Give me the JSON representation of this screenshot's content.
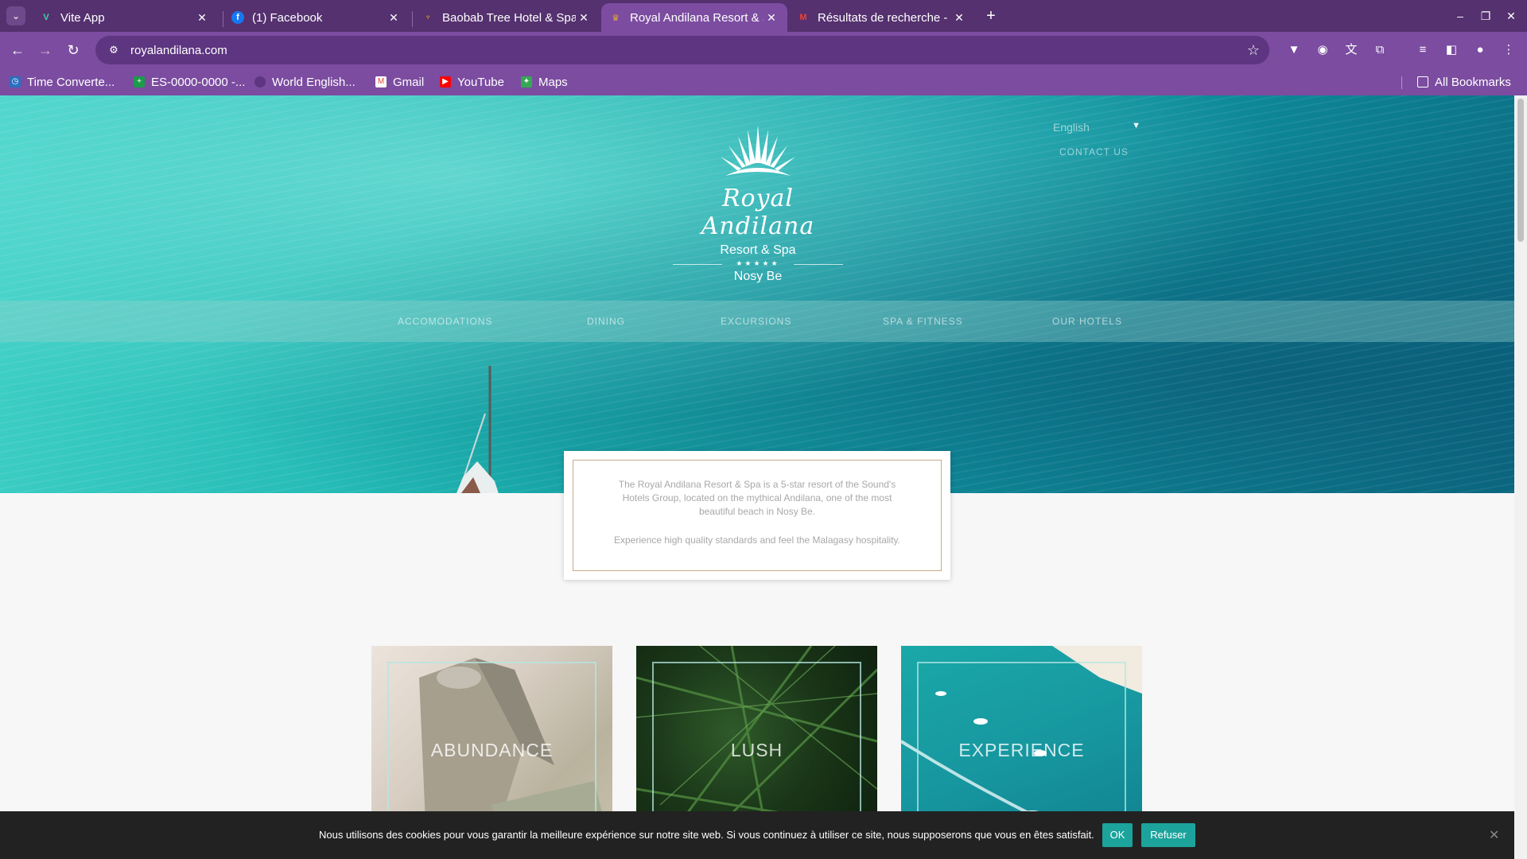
{
  "browser": {
    "tabs": [
      {
        "title": "Vite App",
        "icon": "vite-icon",
        "active": false
      },
      {
        "title": "(1) Facebook",
        "icon": "facebook-icon",
        "active": false
      },
      {
        "title": "Baobab Tree Hotel & Spa",
        "icon": "baobab-icon",
        "active": false
      },
      {
        "title": "Royal Andilana Resort & Spa",
        "icon": "royal-andilana-icon",
        "active": true
      },
      {
        "title": "Résultats de recherche - ",
        "icon": "gmail-icon",
        "active": false
      }
    ],
    "url": "royalandilana.com",
    "bookmarks": [
      {
        "label": "Time Converte...",
        "icon": "clock-icon"
      },
      {
        "label": "ES-0000-0000 -...",
        "icon": "plus-icon"
      },
      {
        "label": "World English...",
        "icon": "globe-icon"
      },
      {
        "label": "Gmail",
        "icon": "gmail-icon"
      },
      {
        "label": "YouTube",
        "icon": "youtube-icon"
      },
      {
        "label": "Maps",
        "icon": "maps-icon"
      }
    ],
    "all_bookmarks": "All Bookmarks"
  },
  "site": {
    "logo": {
      "script": "Royal Andilana",
      "subtitle": "Resort & Spa",
      "stars": "★★★★★",
      "location": "Nosy Be"
    },
    "language": "English",
    "contact": "CONTACT US",
    "menu": [
      "ACCOMODATIONS",
      "DINING",
      "EXCURSIONS",
      "SPA & FITNESS",
      "OUR HOTELS"
    ],
    "intro": {
      "p1": "The Royal Andilana Resort & Spa is a 5-star resort of the Sound's Hotels Group, located on the mythical Andilana, one of the most beautiful beach in Nosy Be.",
      "p2": "Experience high quality standards and feel the Malagasy hospitality."
    },
    "cards": [
      "ABUNDANCE",
      "LUSH",
      "EXPERIENCE"
    ],
    "cookie": {
      "message": "Nous utilisons des cookies pour vous garantir la meilleure expérience sur notre site web. Si vous continuez à utiliser ce site, nous supposerons que vous en êtes satisfait.",
      "ok": "OK",
      "refuse": "Refuser",
      "close": "✕"
    }
  },
  "colors": {
    "tabbar": "#55316f",
    "toolbar": "#7b4ca0",
    "cookie_button": "#1ba39c",
    "intro_border": "#c9a98a"
  }
}
